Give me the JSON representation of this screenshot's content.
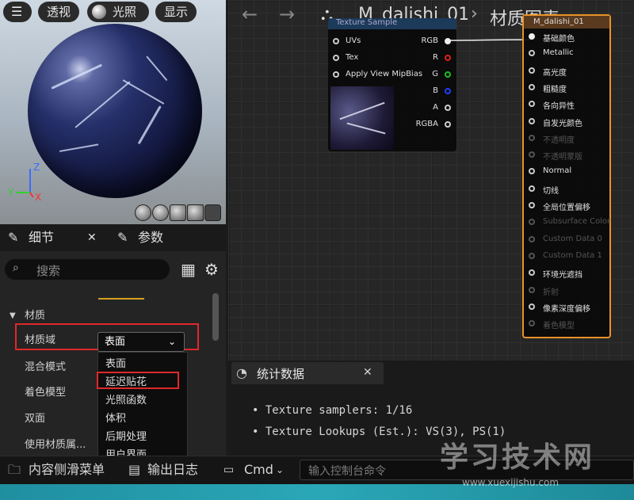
{
  "viewport": {
    "menu_label": "",
    "buttons": [
      "透视",
      "光照",
      "显示"
    ]
  },
  "details": {
    "tabs": [
      "细节",
      "参数"
    ],
    "search_placeholder": "搜索",
    "section": "材质",
    "rows": [
      "材质域",
      "混合模式",
      "着色模型",
      "双面",
      "使用材质属..."
    ],
    "domain_value": "表面",
    "menu_items": [
      "表面",
      "延迟贴花",
      "光照函数",
      "体积",
      "后期处理",
      "用户界面"
    ]
  },
  "graph": {
    "breadcrumb_title": "M_dalishi_01",
    "breadcrumb_sep": "›",
    "breadcrumb_current": "材质图表",
    "texture_node": {
      "title": "Texture Sample",
      "inputs": [
        "UVs",
        "Tex",
        "Apply View MipBias"
      ],
      "outputs": [
        "RGB",
        "R",
        "G",
        "B",
        "A",
        "RGBA"
      ]
    },
    "material_node": {
      "title": "M_dalishi_01",
      "inputs": [
        {
          "label": "基础颜色",
          "enabled": true
        },
        {
          "label": "Metallic",
          "enabled": true
        },
        {
          "label": "高光度",
          "enabled": true
        },
        {
          "label": "粗糙度",
          "enabled": true
        },
        {
          "label": "各向异性",
          "enabled": true
        },
        {
          "label": "自发光颜色",
          "enabled": true
        },
        {
          "label": "不透明度",
          "enabled": false
        },
        {
          "label": "不透明蒙版",
          "enabled": false
        },
        {
          "label": "Normal",
          "enabled": true
        },
        {
          "label": "切线",
          "enabled": true
        },
        {
          "label": "全局位置偏移",
          "enabled": true
        },
        {
          "label": "Subsurface Color",
          "enabled": false
        },
        {
          "label": "Custom Data 0",
          "enabled": false
        },
        {
          "label": "Custom Data 1",
          "enabled": false
        },
        {
          "label": "环境光遮挡",
          "enabled": true
        },
        {
          "label": "折射",
          "enabled": false
        },
        {
          "label": "像素深度偏移",
          "enabled": true
        },
        {
          "label": "着色模型",
          "enabled": false
        }
      ]
    }
  },
  "stats": {
    "tab_label": "统计数据",
    "lines": [
      "Texture samplers: 1/16",
      "Texture Lookups (Est.): VS(3), PS(1)"
    ]
  },
  "bottombar": {
    "content_drawer": "内容侧滑菜单",
    "output_log": "输出日志",
    "cmd_label": "Cmd",
    "cmd_placeholder": "输入控制台命令"
  },
  "watermark": {
    "text": "学习技术网",
    "url": "www.xuexijishu.com"
  },
  "colors": {
    "highlight_red": "#e0282a",
    "node_orange": "#e8922a",
    "pin_r": "#e02020",
    "pin_g": "#20c020",
    "pin_b": "#2040ff"
  }
}
